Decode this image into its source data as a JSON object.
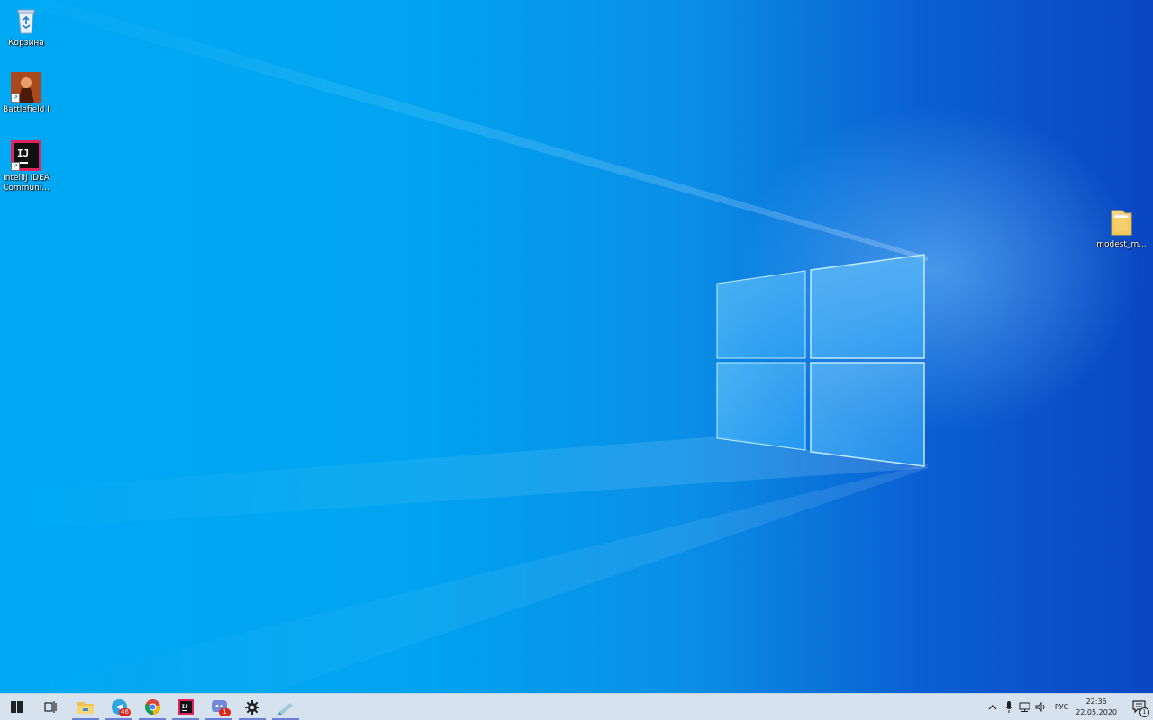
{
  "desktop": {
    "icons": [
      {
        "label": "Корзина",
        "icon": "recycle-bin-icon"
      },
      {
        "label": "Battlefield I",
        "icon": "battlefield-icon"
      },
      {
        "label": "IntelliJ IDEA Communi...",
        "icon": "intellij-idea-icon"
      },
      {
        "label": "modest_m...",
        "icon": "folder-icon"
      }
    ]
  },
  "taskbar": {
    "start_icon": "windows-start-icon",
    "task_view_icon": "task-view-icon",
    "apps": [
      {
        "name": "file-explorer",
        "icon": "folder-icon",
        "badge": ""
      },
      {
        "name": "telegram",
        "icon": "telegram-icon",
        "badge": "46"
      },
      {
        "name": "chrome",
        "icon": "chrome-icon",
        "badge": ""
      },
      {
        "name": "intellij",
        "icon": "intellij-idea-icon",
        "badge": ""
      },
      {
        "name": "discord",
        "icon": "discord-icon",
        "badge": "1"
      },
      {
        "name": "settings",
        "icon": "gear-icon",
        "badge": ""
      },
      {
        "name": "app",
        "icon": "app-icon",
        "badge": ""
      }
    ],
    "tray": {
      "language": "РУС",
      "time": "22:36",
      "date": "22.05.2020",
      "notification_count": "1"
    }
  },
  "colors": {
    "taskbar_bg": "#d6e3ee",
    "running_indicator": "#6a7fd6",
    "badge": "#e2231a"
  }
}
